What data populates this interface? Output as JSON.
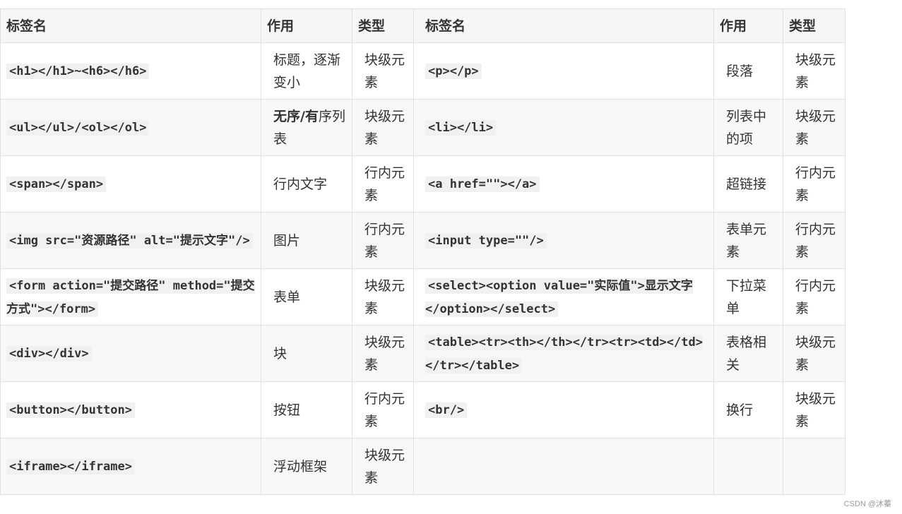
{
  "table": {
    "headers": [
      "标签名",
      "作用",
      "类型",
      "标签名",
      "作用",
      "类型"
    ],
    "rows": [
      {
        "tag1": "<h1></h1>~<h6></h6>",
        "use1": "标题，逐渐变小",
        "type1": "块级元素",
        "tag2": "<p></p>",
        "use2": "段落",
        "type2": "块级元素"
      },
      {
        "tag1": "<ul></ul>/<ol></ol>",
        "use1_bold": "无序/有",
        "use1": "序列表",
        "type1": "块级元素",
        "tag2": "<li></li>",
        "use2": "列表中的项",
        "type2": "块级元素"
      },
      {
        "tag1": "<span></span>",
        "use1": "行内文字",
        "type1": "行内元素",
        "tag2": "<a href=\"\"></a>",
        "use2": "超链接",
        "type2": "行内元素"
      },
      {
        "tag1": "<img src=\"资源路径\" alt=\"提示文字\"/>",
        "use1": "图片",
        "type1": "行内元素",
        "tag2": "<input type=\"\"/>",
        "use2": "表单元素",
        "type2": "行内元素"
      },
      {
        "tag1": "<form action=\"提交路径\" method=\"提交方式\"></form>",
        "use1": "表单",
        "type1": "块级元素",
        "tag2": "<select><option value=\"实际值\">显示文字</option></select>",
        "use2": "下拉菜单",
        "type2": "行内元素"
      },
      {
        "tag1": "<div></div>",
        "use1": "块",
        "type1": "块级元素",
        "tag2": "<table><tr><th></th></tr><tr><td></td></tr></table>",
        "use2": "表格相关",
        "type2": "块级元素"
      },
      {
        "tag1": "<button></button>",
        "use1": "按钮",
        "type1": "行内元素",
        "tag2": "<br/>",
        "use2": "换行",
        "type2": "块级元素"
      },
      {
        "tag1": "<iframe></iframe>",
        "use1": "浮动框架",
        "type1": "块级元素",
        "tag2": "",
        "use2": "",
        "type2": ""
      }
    ]
  },
  "watermark": "CSDN @沐蓁"
}
